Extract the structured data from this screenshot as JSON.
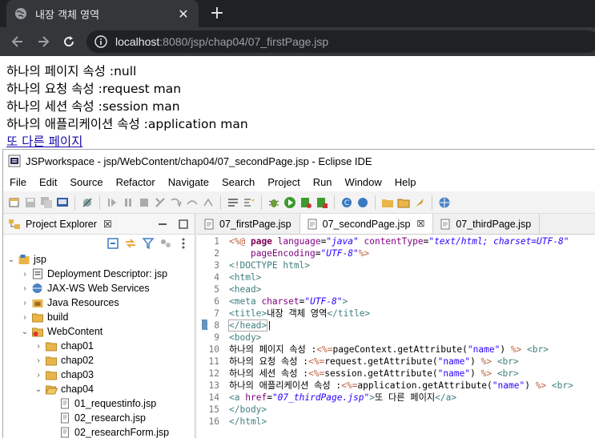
{
  "browser": {
    "tab_title": "내장 객체 영역",
    "close_label": "✕",
    "newtab_label": "+",
    "url_host": "localhost",
    "url_rest": ":8080/jsp/chap04/07_firstPage.jsp"
  },
  "page": {
    "lines": [
      "하나의 페이지 속성 :null",
      "하나의 요청 속성 :request man",
      "하나의 세션 속성 :session man",
      "하나의 애플리케이션 속성 :application man"
    ],
    "link_text": "또 다른 페이지"
  },
  "eclipse": {
    "title": "JSPworkspace - jsp/WebContent/chap04/07_secondPage.jsp - Eclipse IDE",
    "menu": [
      "File",
      "Edit",
      "Source",
      "Refactor",
      "Navigate",
      "Search",
      "Project",
      "Run",
      "Window",
      "Help"
    ],
    "explorer_title": "Project Explorer",
    "explorer_close": "☒",
    "tree": [
      {
        "label": "jsp",
        "arrow": "⌄",
        "icon": "project-icon"
      },
      {
        "label": "Deployment Descriptor: jsp",
        "arrow": "›",
        "icon": "descriptor-icon"
      },
      {
        "label": "JAX-WS Web Services",
        "arrow": "›",
        "icon": "webservice-icon"
      },
      {
        "label": "Java Resources",
        "arrow": "›",
        "icon": "java-resources-icon"
      },
      {
        "label": "build",
        "arrow": "›",
        "icon": "folder-icon"
      },
      {
        "label": "WebContent",
        "arrow": "⌄",
        "icon": "webcontent-folder-icon"
      },
      {
        "label": "chap01",
        "arrow": "›",
        "icon": "folder-icon"
      },
      {
        "label": "chap02",
        "arrow": "›",
        "icon": "folder-icon"
      },
      {
        "label": "chap03",
        "arrow": "›",
        "icon": "folder-icon"
      },
      {
        "label": "chap04",
        "arrow": "⌄",
        "icon": "folder-open-icon"
      },
      {
        "label": "01_requestinfo.jsp",
        "arrow": "",
        "icon": "jsp-file-icon"
      },
      {
        "label": "02_research.jsp",
        "arrow": "",
        "icon": "jsp-file-icon"
      },
      {
        "label": "02_researchForm.jsp",
        "arrow": "",
        "icon": "jsp-file-icon"
      }
    ],
    "editor_tabs": [
      {
        "label": "07_firstPage.jsp",
        "active": false
      },
      {
        "label": "07_secondPage.jsp",
        "active": true,
        "close": "☒"
      },
      {
        "label": "07_thirdPage.jsp",
        "active": false
      }
    ],
    "code_lines": [
      "1",
      "2",
      "3",
      "4",
      "5",
      "6",
      "7",
      "8",
      "9",
      "10",
      "11",
      "12",
      "13",
      "14",
      "15",
      "16"
    ],
    "colors": {
      "keyword": "#7f0055",
      "tag": "#3f7f7f",
      "attribute": "#7f007f",
      "string": "#2a00ff",
      "jsp": "#bf5f3f"
    }
  }
}
